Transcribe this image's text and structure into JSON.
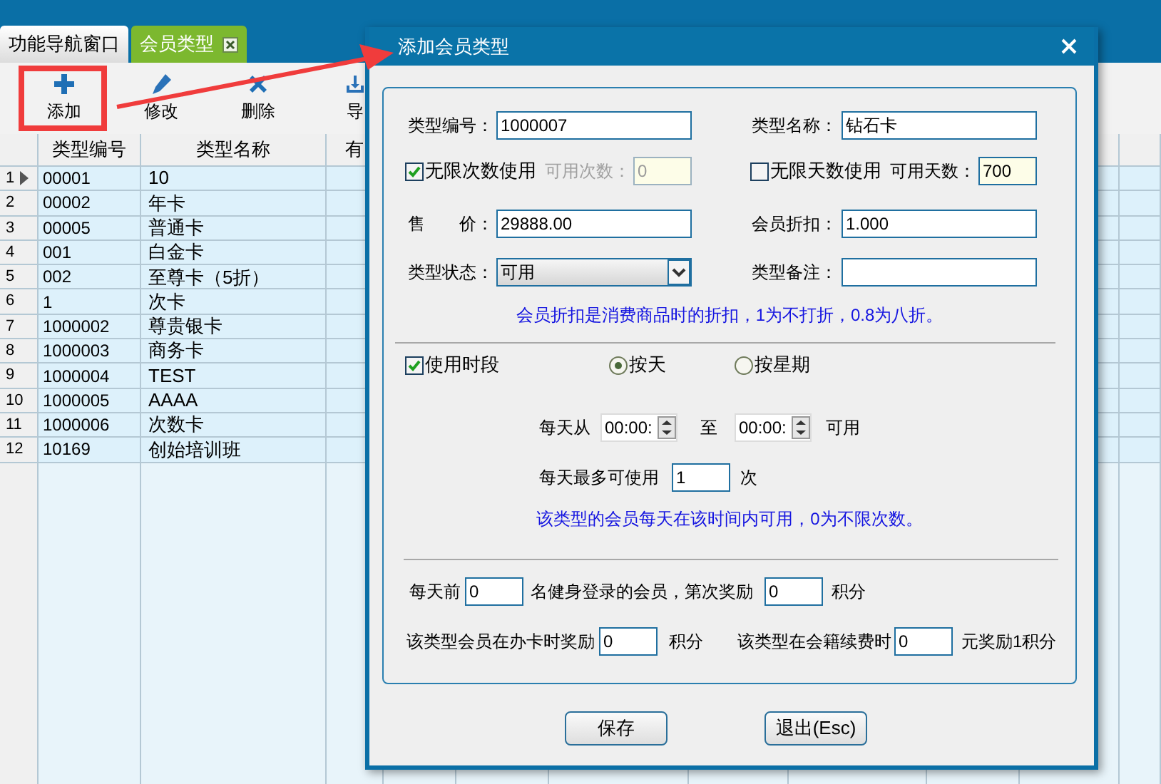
{
  "tabs": [
    {
      "label": "功能导航窗口",
      "selected": false,
      "closable": false
    },
    {
      "label": "会员类型",
      "selected": true,
      "closable": true
    }
  ],
  "toolbar": [
    {
      "kind": "add",
      "label": "添加"
    },
    {
      "kind": "edit",
      "label": "修改"
    },
    {
      "kind": "delete",
      "label": "删除"
    },
    {
      "kind": "export",
      "label": "导"
    }
  ],
  "table": {
    "columns": [
      "类型编号",
      "类型名称",
      "有"
    ],
    "rows": [
      {
        "number": "1",
        "code": "00001",
        "name": "10",
        "current": true
      },
      {
        "number": "2",
        "code": "00002",
        "name": "年卡",
        "current": false
      },
      {
        "number": "3",
        "code": "00005",
        "name": "普通卡",
        "current": false
      },
      {
        "number": "4",
        "code": "001",
        "name": "白金卡",
        "current": false
      },
      {
        "number": "5",
        "code": "002",
        "name": "至尊卡（5折）",
        "current": false
      },
      {
        "number": "6",
        "code": "1",
        "name": "次卡",
        "current": false
      },
      {
        "number": "7",
        "code": "1000002",
        "name": "尊贵银卡",
        "current": false
      },
      {
        "number": "8",
        "code": "1000003",
        "name": "商务卡",
        "current": false
      },
      {
        "number": "9",
        "code": "1000004",
        "name": "TEST",
        "current": false
      },
      {
        "number": "10",
        "code": "1000005",
        "name": "AAAA",
        "current": false
      },
      {
        "number": "11",
        "code": "1000006",
        "name": "次数卡",
        "current": false
      },
      {
        "number": "12",
        "code": "10169",
        "name": "创始培训班",
        "current": false
      }
    ]
  },
  "dialog": {
    "title": "添加会员类型",
    "basic": {
      "type_code": {
        "label": "类型编号：",
        "value": "1000007"
      },
      "type_name": {
        "label": "类型名称：",
        "value": "钻石卡"
      },
      "unlimited_count": {
        "label": "无限次数使用",
        "checked": true
      },
      "available_count": {
        "label": "可用次数：",
        "value": "0",
        "disabled": true
      },
      "unlimited_days": {
        "label": "无限天数使用",
        "checked": false
      },
      "available_days": {
        "label": "可用天数：",
        "value": "700"
      },
      "price": {
        "label": "售　　价：",
        "value": "29888.00"
      },
      "discount": {
        "label": "会员折扣：",
        "value": "1.000"
      },
      "status": {
        "label": "类型状态：",
        "value": "可用"
      },
      "remark": {
        "label": "类型备注："
      },
      "note": "会员折扣是消费商品时的折扣，1为不打折，0.8为八折。"
    },
    "period": {
      "use_period": {
        "label": "使用时段",
        "checked": true
      },
      "modes": [
        {
          "label": "按天",
          "selected": true
        },
        {
          "label": "按星期",
          "selected": false
        }
      ],
      "from_label": "每天从",
      "from_time": "00:00:",
      "to_label": "至",
      "to_time": "00:00:",
      "available_label": "可用",
      "max_label": "每天最多可使用",
      "max_value": "1",
      "max_unit": "次",
      "note": "该类型的会员每天在该时间内可用，0为不限次数。"
    },
    "points": {
      "prefix": "每天前",
      "top_n": "0",
      "middle": "名健身登录的会员，第次奖励",
      "reward": "0",
      "unit": "积分",
      "issue_label": "该类型会员在办卡时奖励",
      "issue_value": "0",
      "issue_unit": "积分",
      "renew_label": "该类型在会籍续费时",
      "renew_value": "0",
      "renew_unit": "元奖励1积分"
    },
    "buttons": [
      "保存",
      "退出(Esc)"
    ]
  }
}
